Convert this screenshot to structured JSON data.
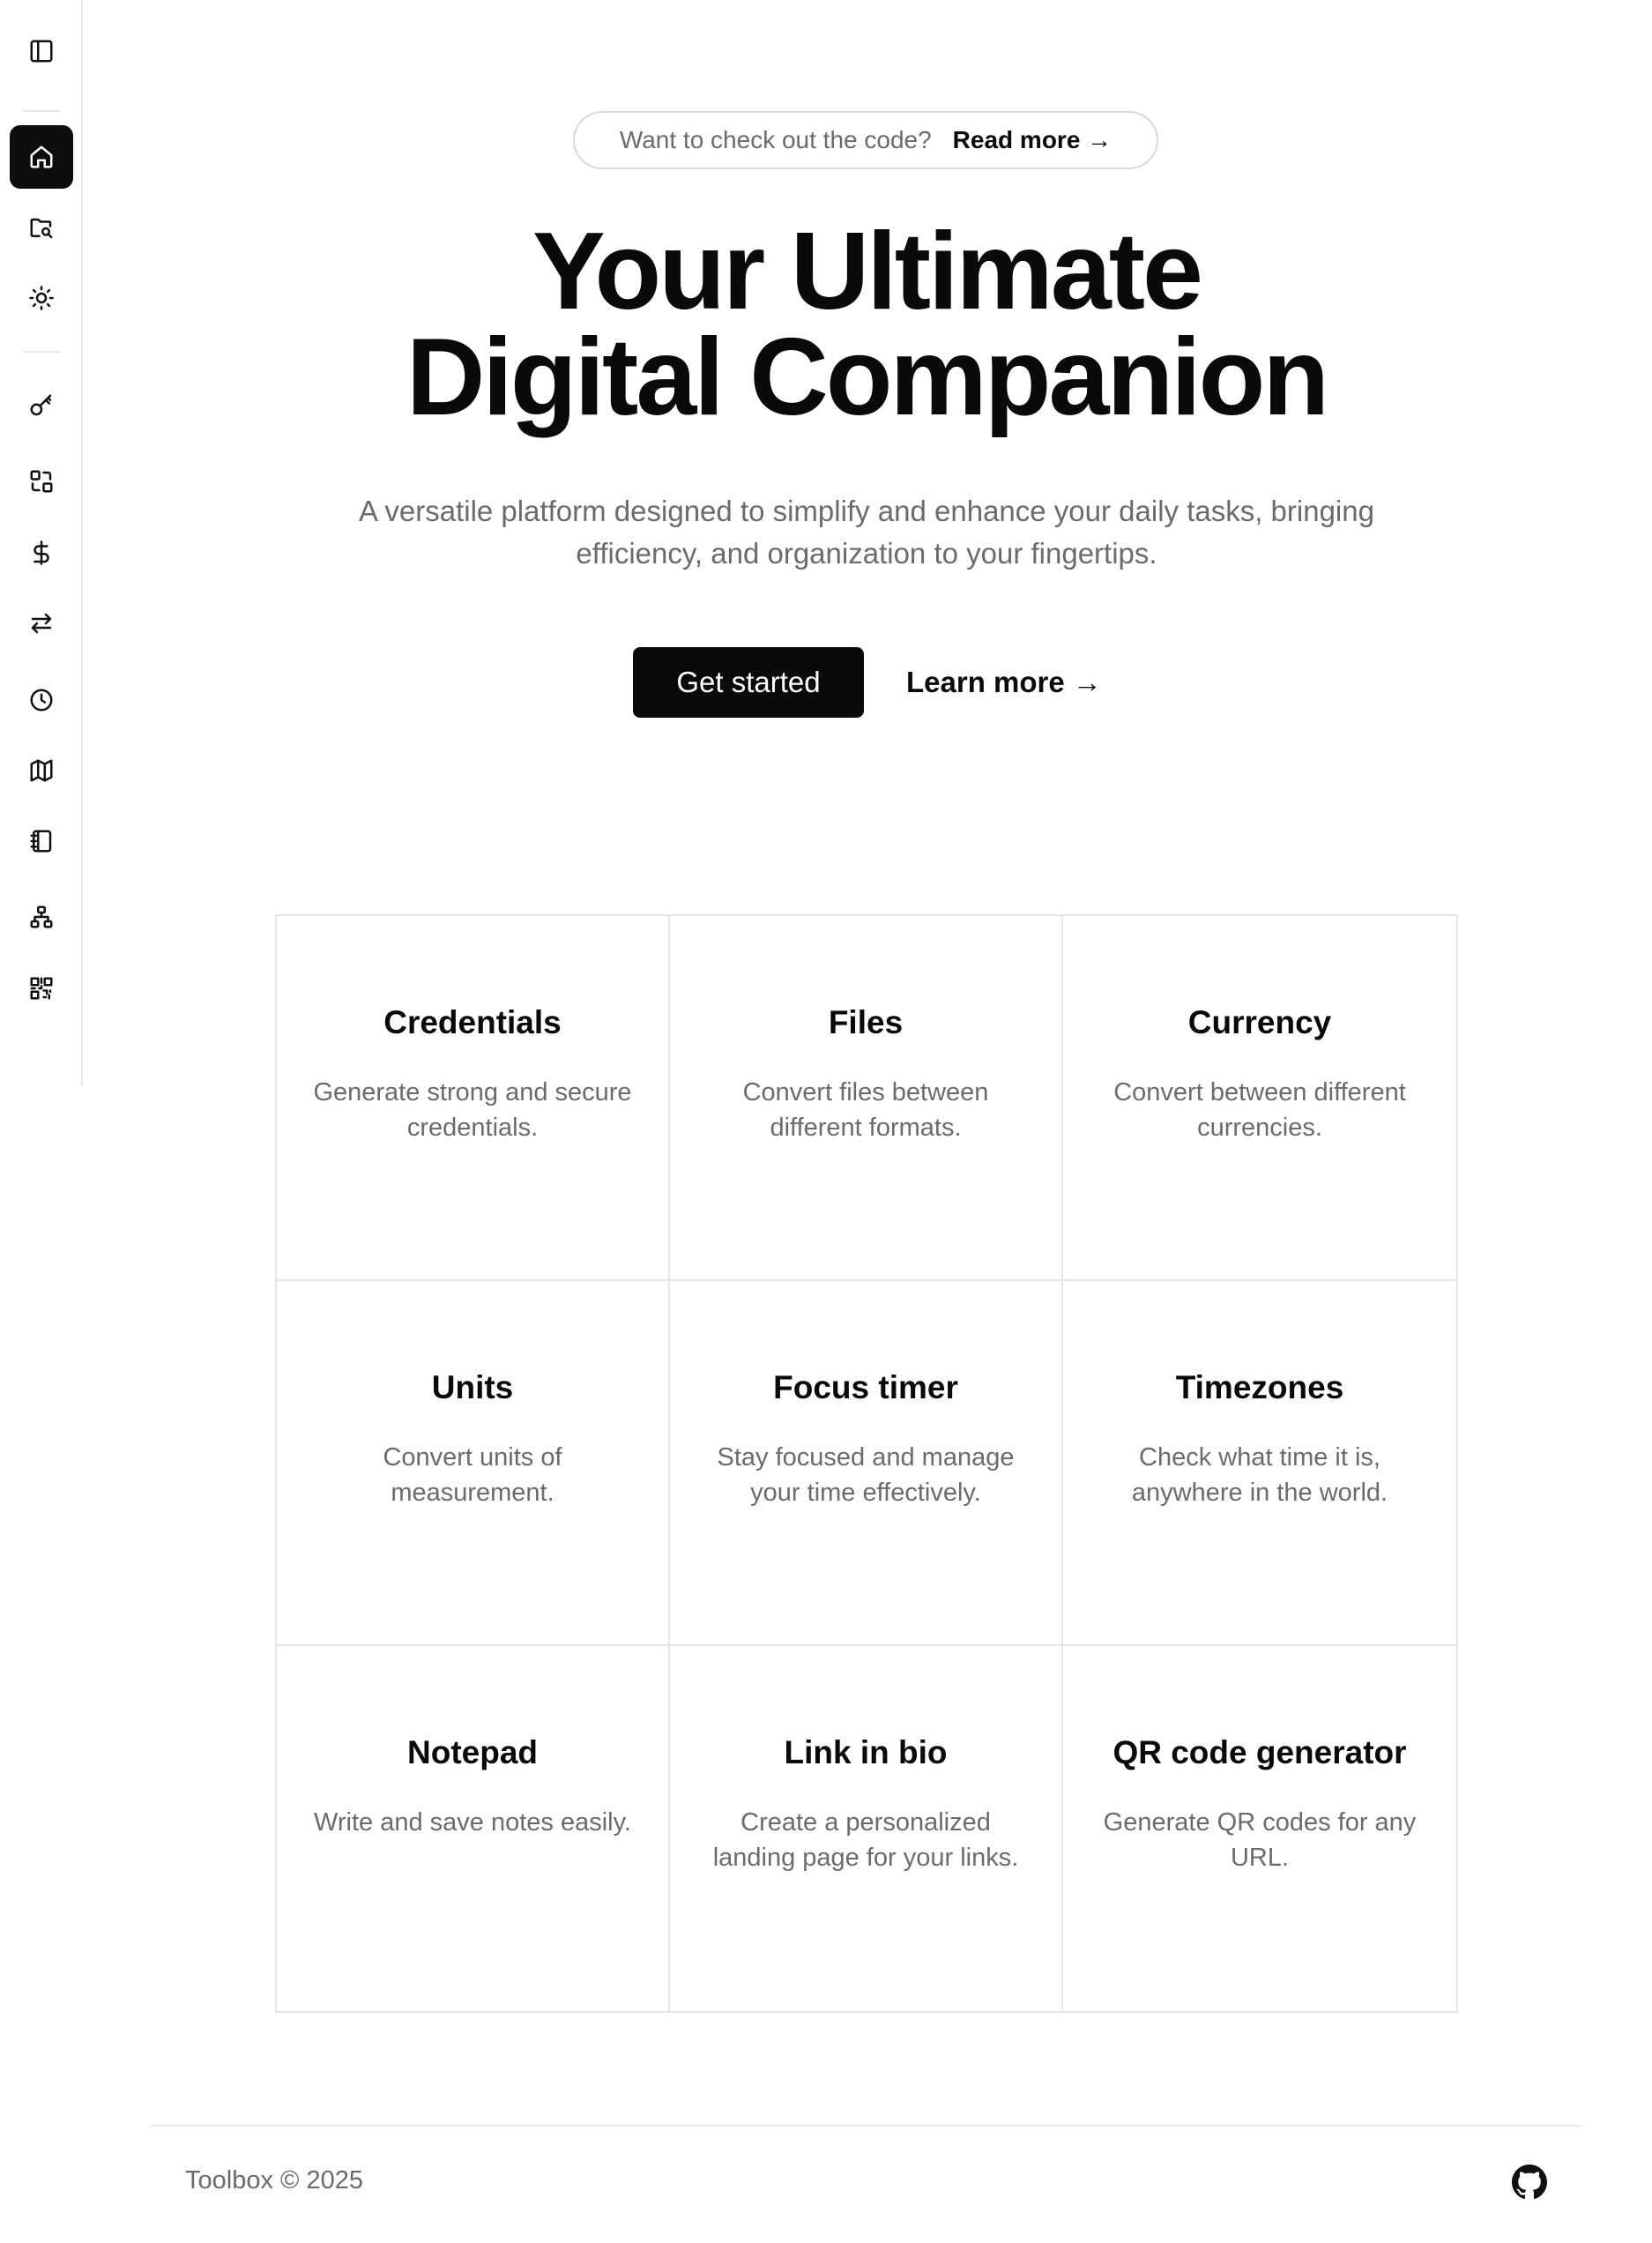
{
  "sidebar": {
    "items": [
      {
        "icon": "panel-toggle-icon",
        "name": "sidebar-toggle-button"
      },
      {
        "icon": "home-icon",
        "name": "sidebar-item-home",
        "active": true
      },
      {
        "icon": "folder-search-icon",
        "name": "sidebar-item-files-browser"
      },
      {
        "icon": "sun-icon",
        "name": "sidebar-item-theme"
      },
      {
        "icon": "key-icon",
        "name": "sidebar-item-credentials"
      },
      {
        "icon": "file-convert-icon",
        "name": "sidebar-item-files"
      },
      {
        "icon": "dollar-icon",
        "name": "sidebar-item-currency"
      },
      {
        "icon": "arrows-swap-icon",
        "name": "sidebar-item-units"
      },
      {
        "icon": "clock-icon",
        "name": "sidebar-item-focus-timer"
      },
      {
        "icon": "map-icon",
        "name": "sidebar-item-timezones"
      },
      {
        "icon": "notebook-icon",
        "name": "sidebar-item-notepad"
      },
      {
        "icon": "sitemap-icon",
        "name": "sidebar-item-link-in-bio"
      },
      {
        "icon": "qr-code-icon",
        "name": "sidebar-item-qr-code"
      }
    ]
  },
  "announcement": {
    "text": "Want to check out the code?",
    "link": "Read more →"
  },
  "hero": {
    "title_line1": "Your Ultimate",
    "title_line2": "Digital Companion",
    "subtitle": "A versatile platform designed to simplify and enhance your daily tasks, bringing efficiency, and organization to your fingertips.",
    "primary_button": "Get started",
    "secondary_link": "Learn more →"
  },
  "features": [
    {
      "title": "Credentials",
      "description": "Generate strong and secure credentials."
    },
    {
      "title": "Files",
      "description": "Convert files between different formats."
    },
    {
      "title": "Currency",
      "description": "Convert between different currencies."
    },
    {
      "title": "Units",
      "description": "Convert units of measurement."
    },
    {
      "title": "Focus timer",
      "description": "Stay focused and manage your time effectively."
    },
    {
      "title": "Timezones",
      "description": "Check what time it is, anywhere in the world."
    },
    {
      "title": "Notepad",
      "description": "Write and save notes easily."
    },
    {
      "title": "Link in bio",
      "description": "Create a personalized landing page for your links."
    },
    {
      "title": "QR code generator",
      "description": "Generate QR codes for any URL."
    }
  ],
  "footer": {
    "copyright": "Toolbox © 2025",
    "github_icon": "github-icon"
  },
  "colors": {
    "primary": "#0a0a0a",
    "muted_text": "#6b6b6b",
    "border": "#e5e5e5"
  }
}
